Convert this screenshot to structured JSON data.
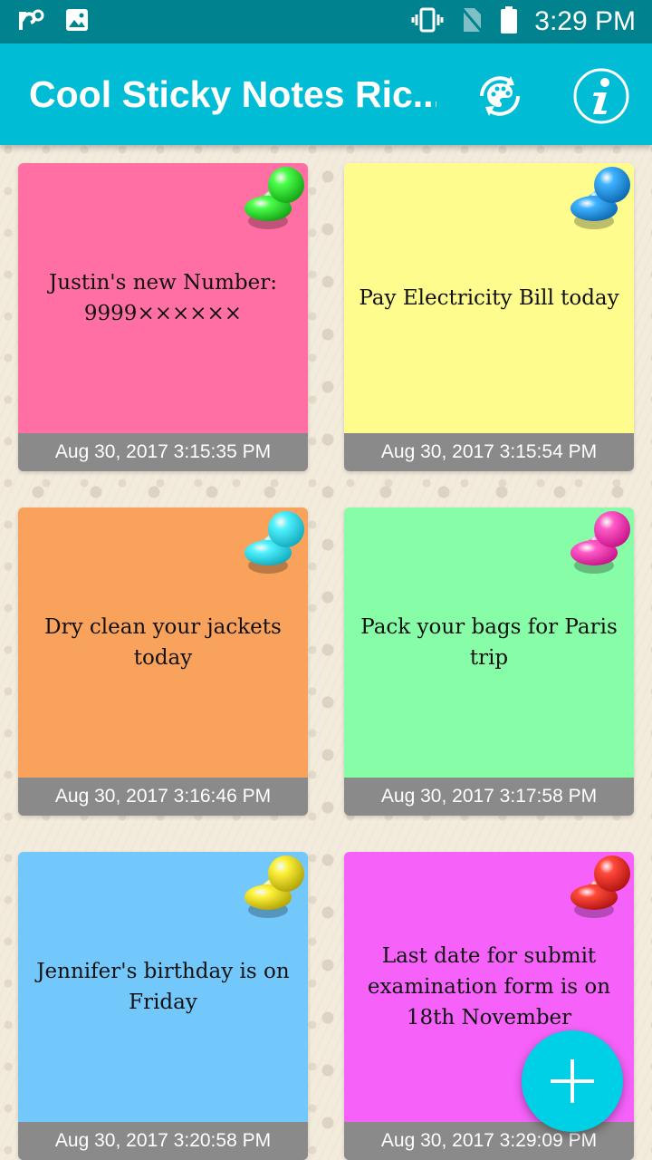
{
  "status_bar": {
    "time": "3:29 PM",
    "icons": [
      "np-app-icon",
      "image-icon",
      "vibrate-icon",
      "no-sim-icon",
      "battery-icon"
    ]
  },
  "app_bar": {
    "title": "Cool Sticky Notes Ric...",
    "actions": [
      "palette-refresh-icon",
      "info-icon"
    ],
    "color": "#00bcd4"
  },
  "notes": [
    {
      "text": "Justin's new Number: 9999××××××",
      "date": "Aug 30, 2017 3:15:35 PM",
      "color": "#ff6fa3",
      "pin": "green"
    },
    {
      "text": "Pay Electricity Bill today",
      "date": "Aug 30, 2017 3:15:54 PM",
      "color": "#fefc8c",
      "pin": "blue"
    },
    {
      "text": "Dry clean your jackets today",
      "date": "Aug 30, 2017 3:16:46 PM",
      "color": "#f9a25c",
      "pin": "cyan"
    },
    {
      "text": "Pack your bags for Paris trip",
      "date": "Aug 30, 2017 3:17:58 PM",
      "color": "#86fda6",
      "pin": "pink"
    },
    {
      "text": "Jennifer's birthday is on Friday",
      "date": "Aug 30, 2017 3:20:58 PM",
      "color": "#73c8fb",
      "pin": "yellow"
    },
    {
      "text": "Last date for submit examination form is on 18th November",
      "date": "Aug 30, 2017 3:29:09 PM",
      "color": "#f561f9",
      "pin": "red"
    }
  ],
  "fab": {
    "icon": "plus-icon",
    "color": "#00d0e6"
  }
}
